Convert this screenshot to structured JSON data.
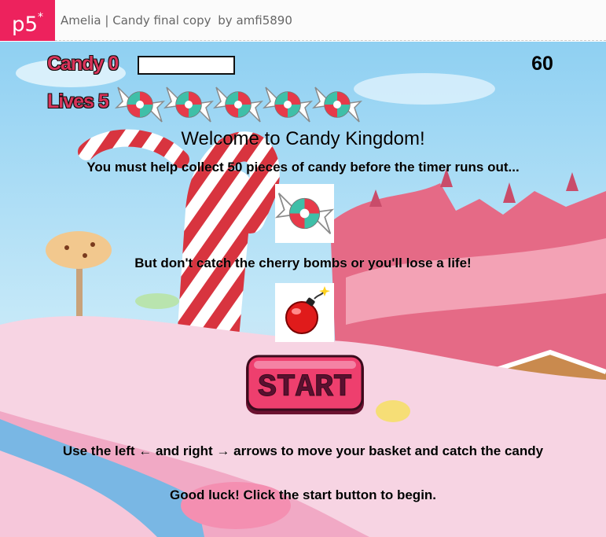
{
  "app": {
    "logo": "p5",
    "logo_mark": "*",
    "sketch_name": "Amelia | Candy final copy",
    "by_label": "by",
    "author": "amfi5890"
  },
  "hud": {
    "candy_label": "Candy 0",
    "candy_progress": 0,
    "timer": "60",
    "lives_label": "Lives 5",
    "lives_count": 5,
    "life_icon": "wrapped-candy-icon"
  },
  "intro": {
    "title": "Welcome to Candy Kingdom!",
    "collect_text": "You must help collect 50 pieces of candy before the timer runs out...",
    "candy_icon": "wrapped-candy-icon",
    "warning_text": "But don't catch the cherry bombs or you'll lose a life!",
    "bomb_icon": "cherry-bomb-icon",
    "start_label": "START",
    "controls_text": "Use the left ← and right → arrows to move your basket and catch the candy",
    "goodluck_text": "Good luck! Click the start button to begin."
  },
  "colors": {
    "brand": "#ed225d",
    "hud_text": "#d9345a",
    "start_button": "#ee3f6e",
    "sky": "#a9d8f5"
  }
}
